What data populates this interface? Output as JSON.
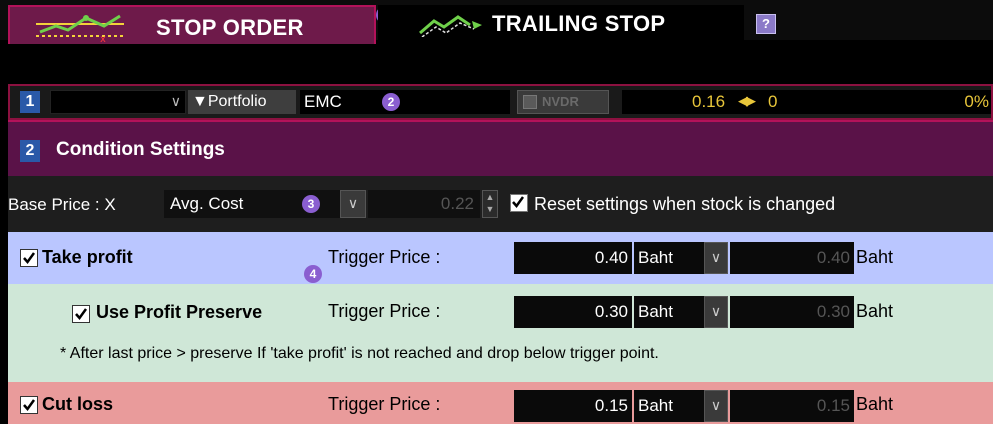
{
  "tabs": {
    "stop_order": "STOP ORDER",
    "trailing_stop": "TRAILING STOP",
    "help": "?"
  },
  "badges": [
    "1",
    "2",
    "3",
    "4"
  ],
  "stock_bar": {
    "section_number": "1",
    "portfolio_label": "▼Portfolio",
    "symbol": "EMC",
    "nvdr_label": "NVDR",
    "last_price": "0.16",
    "change": "0",
    "percent_change": "0%"
  },
  "condition": {
    "section_number": "2",
    "title": "Condition Settings"
  },
  "base_price": {
    "label": "Base Price : X",
    "selected": "Avg. Cost",
    "value": "0.22",
    "reset_label": "Reset settings when stock is changed",
    "reset_checked": true
  },
  "take_profit": {
    "label": "Take profit",
    "checked": true,
    "trigger_label": "Trigger Price :",
    "value": "0.40",
    "unit": "Baht",
    "result": "0.40",
    "result_unit": "Baht"
  },
  "profit_preserve": {
    "label": "Use Profit Preserve",
    "checked": true,
    "trigger_label": "Trigger Price :",
    "value": "0.30",
    "unit": "Baht",
    "result": "0.30",
    "result_unit": "Baht",
    "note": "* After last price > preserve If 'take profit' is not reached and drop below trigger point."
  },
  "cut_loss": {
    "label": "Cut loss",
    "checked": true,
    "trigger_label": "Trigger Price :",
    "value": "0.15",
    "unit": "Baht",
    "result": "0.15",
    "result_unit": "Baht"
  },
  "colors": {
    "accent": "#b3125a",
    "header_bg": "#5a1248",
    "take_profit_bg": "#bac6ff",
    "preserve_bg": "#cfe7d7",
    "cut_loss_bg": "#e99b9b",
    "price_text": "#e8c63a"
  }
}
